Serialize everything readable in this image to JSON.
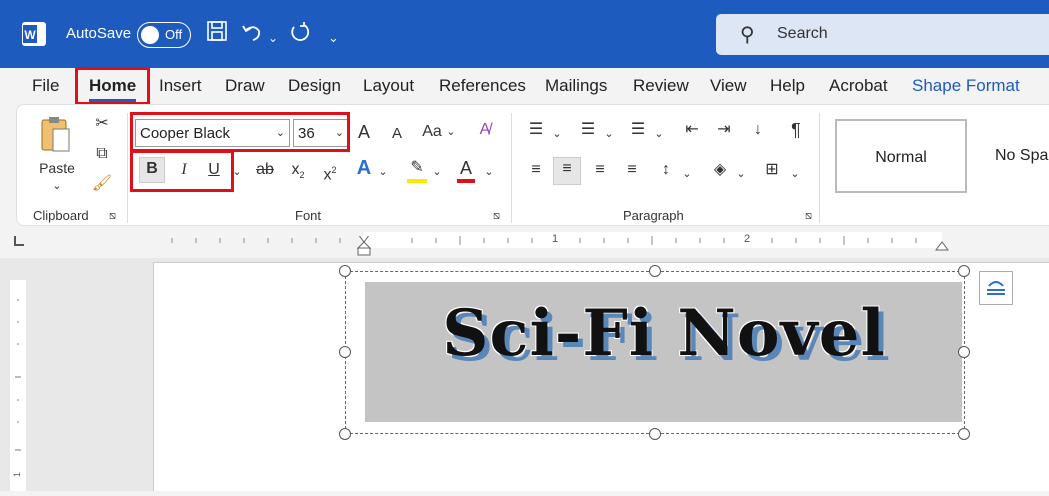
{
  "titlebar": {
    "autosave_label": "AutoSave",
    "autosave_state": "Off",
    "search_placeholder": "Search",
    "app_icon": "word-icon",
    "icons": [
      "save-icon",
      "undo-icon",
      "redo-icon",
      "customize-icon"
    ]
  },
  "tabs": [
    {
      "label": "File"
    },
    {
      "label": "Home"
    },
    {
      "label": "Insert"
    },
    {
      "label": "Draw"
    },
    {
      "label": "Design"
    },
    {
      "label": "Layout"
    },
    {
      "label": "References"
    },
    {
      "label": "Mailings"
    },
    {
      "label": "Review"
    },
    {
      "label": "View"
    },
    {
      "label": "Help"
    },
    {
      "label": "Acrobat"
    },
    {
      "label": "Shape Format"
    }
  ],
  "ribbon": {
    "clipboard": {
      "paste_label": "Paste",
      "group_label": "Clipboard"
    },
    "font": {
      "font_name": "Cooper Black",
      "font_size": "36",
      "group_label": "Font",
      "bold": "B",
      "italic": "I",
      "underline": "U",
      "change_case": "Aa",
      "grow": "A",
      "shrink": "A",
      "strike": "ab",
      "subscript": "x",
      "superscript": "x",
      "effects": "A",
      "font_color": "A"
    },
    "paragraph": {
      "group_label": "Paragraph"
    },
    "styles": [
      {
        "label": "Normal"
      },
      {
        "label": "No Spa"
      }
    ]
  },
  "ruler": {
    "numbers": [
      "1",
      "2"
    ]
  },
  "document": {
    "wordart_text": "Sci-Fi Novel"
  },
  "colors": {
    "accent": "#1e5bbf",
    "highlight_box": "#e0101b",
    "wordart_shadow": "#5b86b8",
    "highlight_yellow": "#ffe600",
    "font_color_red": "#e0101b"
  }
}
